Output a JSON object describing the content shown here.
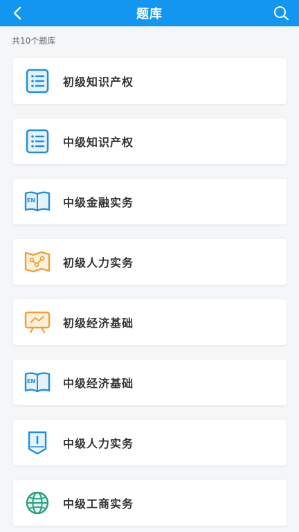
{
  "header": {
    "title": "题库",
    "back_icon": "chevron-left-icon",
    "search_icon": "search-icon",
    "background_color": "#1296f0"
  },
  "summary": {
    "count_text": "共10个题库"
  },
  "banks": [
    {
      "label": "初级知识产权",
      "icon": "list-document-icon",
      "color": "#1e8fe0"
    },
    {
      "label": "中级知识产权",
      "icon": "list-document-icon",
      "color": "#1e8fe0"
    },
    {
      "label": "中级金融实务",
      "icon": "en-book-icon",
      "color": "#1e8fe0"
    },
    {
      "label": "初级人力实务",
      "icon": "map-route-icon",
      "color": "#f0a030"
    },
    {
      "label": "初级经济基础",
      "icon": "presentation-board-icon",
      "color": "#f0a030"
    },
    {
      "label": "中级经济基础",
      "icon": "en-book-icon",
      "color": "#1e8fe0"
    },
    {
      "label": "中级人力实务",
      "icon": "bookmark-icon",
      "color": "#1e8fe0"
    },
    {
      "label": "中级工商实务",
      "icon": "globe-icon",
      "color": "#27a07e"
    }
  ]
}
